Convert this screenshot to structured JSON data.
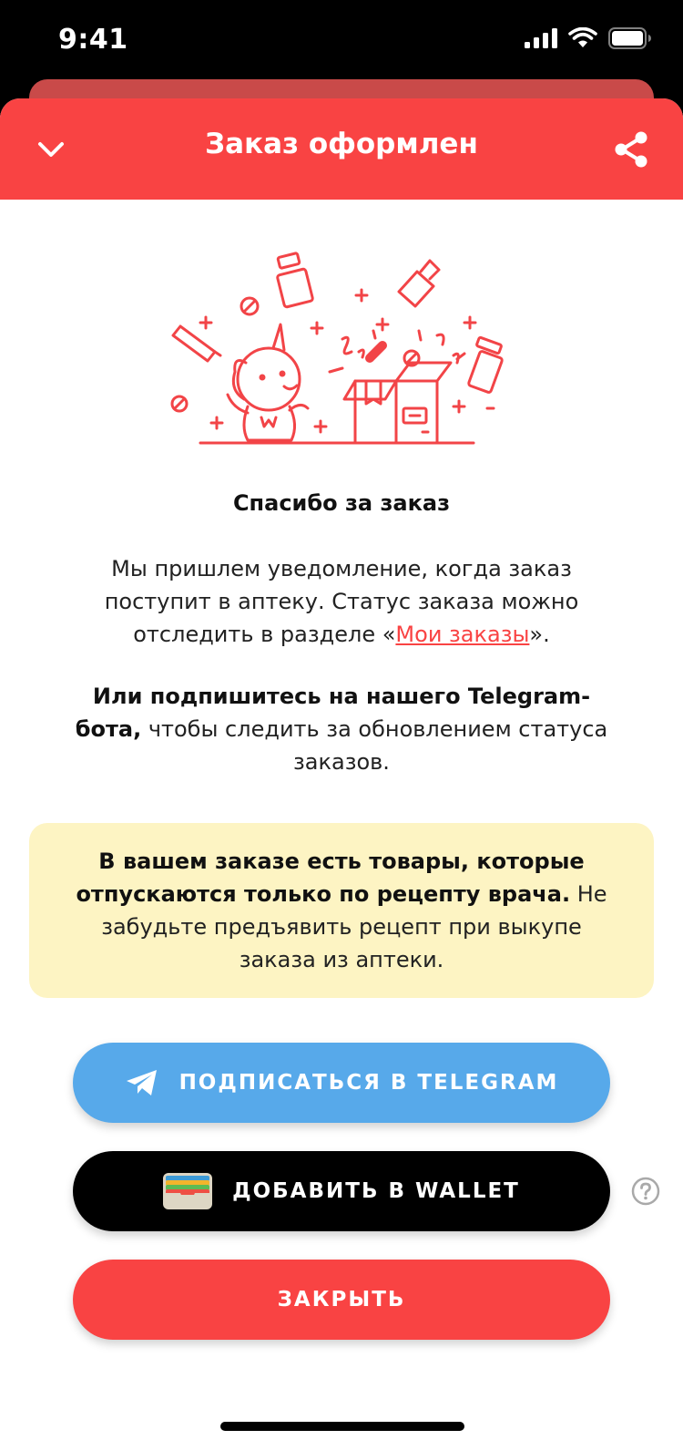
{
  "status_bar": {
    "time": "9:41"
  },
  "header": {
    "title": "Заказ оформлен",
    "back_icon": "chevron-down-icon",
    "share_icon": "share-icon",
    "background_color": "#f94343"
  },
  "content": {
    "thanks_title": "Спасибо за заказ",
    "notify_text_before_link": "Мы пришлем уведомление, когда заказ поступит в аптеку. Статус заказа можно отследить в разделе «",
    "notify_link": "Мои заказы",
    "notify_text_after_link": "».",
    "telegram_bold": "Или подпишитесь на нашего Telegram-бота,",
    "telegram_rest": " чтобы следить за обновлением статуса заказов."
  },
  "warning": {
    "bold": "В вашем заказе есть товары, которые отпускаются только по рецепту врача.",
    "rest": " Не забудьте предъявить рецепт при выкупе заказа из аптеки.",
    "background_color": "#fdf4c3"
  },
  "buttons": {
    "telegram_label": "ПОДПИСАТЬСЯ В TELEGRAM",
    "telegram_color": "#57a9ea",
    "wallet_label": "ДОБАВИТЬ В WALLET",
    "wallet_color": "#000000",
    "close_label": "ЗАКРЫТЬ",
    "close_color": "#f94343"
  }
}
